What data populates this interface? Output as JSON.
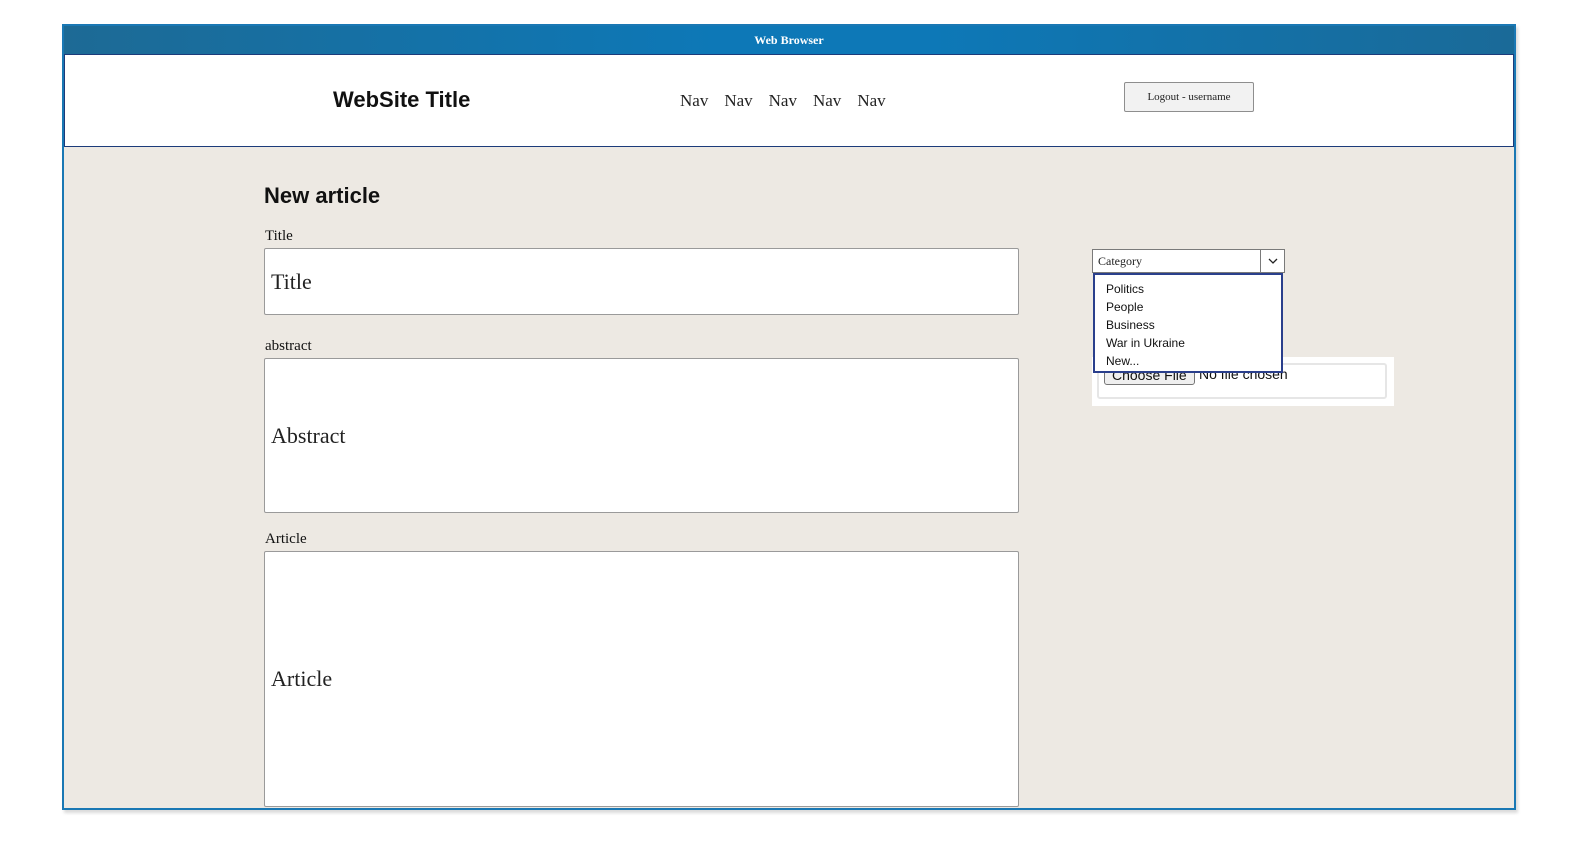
{
  "browser": {
    "title": "Web Browser"
  },
  "header": {
    "site_title": "WebSite Title",
    "nav": [
      "Nav",
      "Nav",
      "Nav",
      "Nav",
      "Nav"
    ],
    "logout_label": "Logout - username"
  },
  "form": {
    "heading": "New article",
    "title_label": "Title",
    "title_placeholder": "Title",
    "abstract_label": "abstract",
    "abstract_placeholder": "Abstract",
    "article_label": "Article",
    "article_placeholder": "Article"
  },
  "category": {
    "selected": "Category",
    "options": [
      "Politics",
      "People",
      "Business",
      "War in Ukraine",
      "New..."
    ]
  },
  "file": {
    "button_label": "Choose File",
    "status": "No file chosen"
  },
  "colors": {
    "titlebar": "#0d78b7",
    "page_background": "#ede9e3",
    "dropdown_border": "#2a3f8c"
  }
}
